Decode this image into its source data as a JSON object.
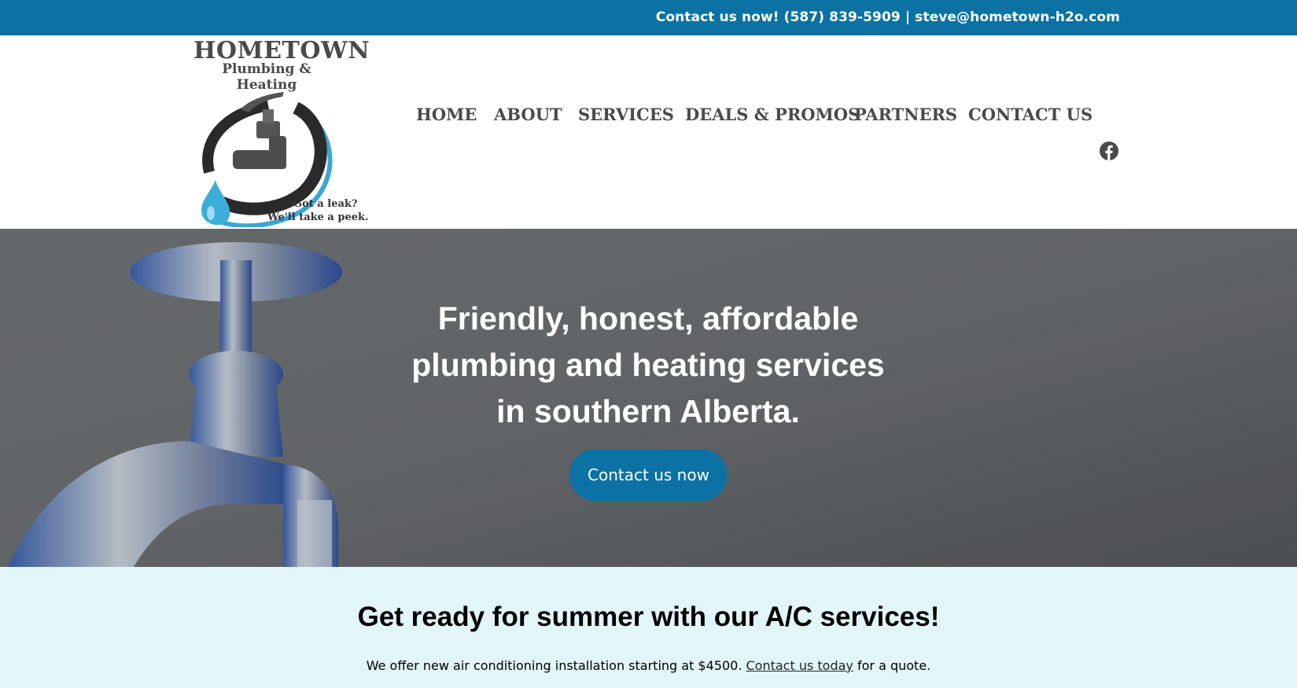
{
  "topbar": {
    "contact": "Contact us now! (587) 839-5909 | steve@hometown-h2o.com"
  },
  "logo": {
    "title": "HOMETOWN",
    "subtitle": "Plumbing & Heating",
    "tagline_1": "Got a leak?",
    "tagline_2": "We'll take a peek."
  },
  "nav": {
    "items": [
      "HOME",
      "ABOUT",
      "SERVICES",
      "DEALS & PROMOS",
      "PARTNERS",
      "CONTACT US"
    ],
    "social_icon": "facebook-icon"
  },
  "hero": {
    "title_line_1": "Friendly, honest, affordable",
    "title_line_2": "plumbing and heating services",
    "title_line_3": "in southern Alberta.",
    "button_label": "Contact us now"
  },
  "promo": {
    "heading": "Get ready for summer with our A/C services!",
    "text_before": "We offer new air conditioning installation starting at $4500. ",
    "link_label": "Contact us today",
    "text_after": " for a quote."
  },
  "colors": {
    "brand_blue": "#0b72a3",
    "nav_text": "#4a4a4a",
    "promo_bg": "#e2f5f8"
  }
}
